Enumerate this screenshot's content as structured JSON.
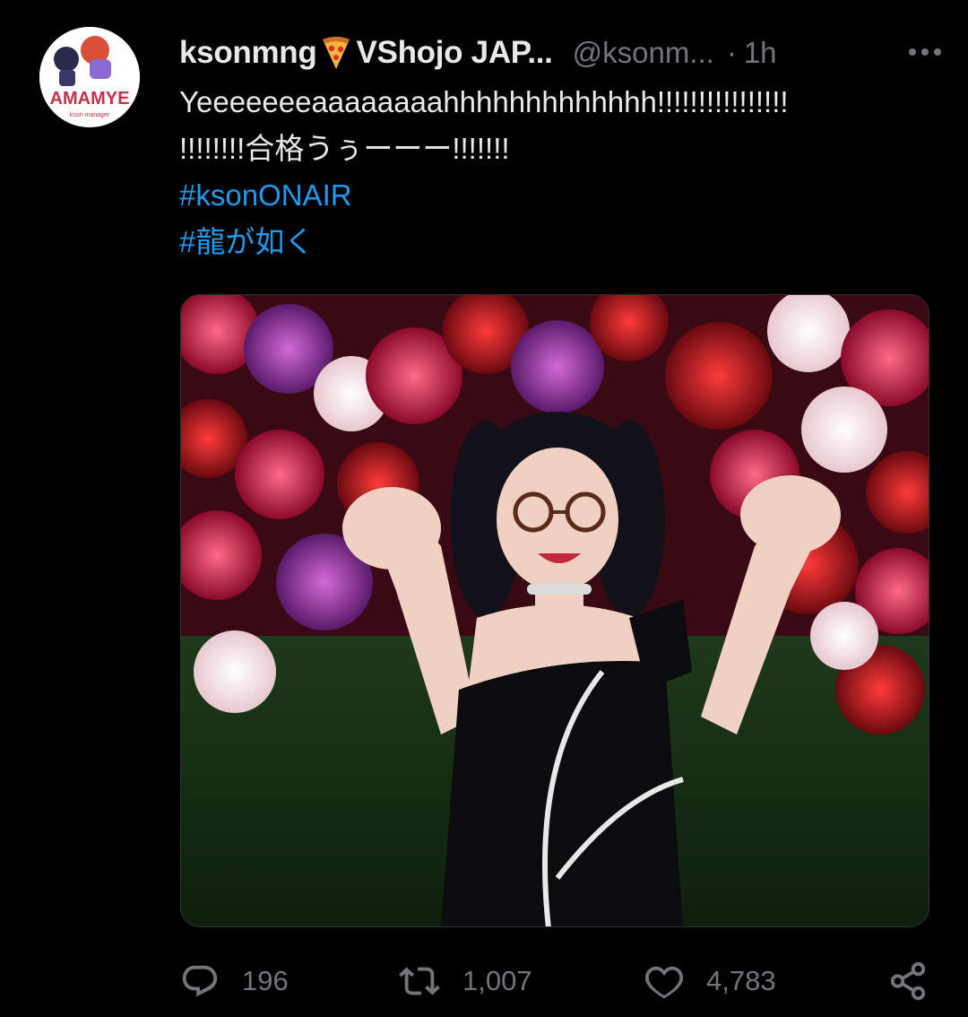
{
  "tweet": {
    "display_name": "ksonmng",
    "display_name_suffix": "VShojo JAP...",
    "handle": "@ksonm...",
    "separator": "·",
    "time": "1h",
    "text_line_1": "Yeeeeeeeaaaaaaaahhhhhhhhhhhhh!!!!!!!!!!!!!!!!",
    "text_line_2": "!!!!!!!!合格うぅーーー!!!!!!!",
    "hashtags": [
      "#ksonONAIR",
      "#龍が如く"
    ],
    "avatar_icon": "avatar-icon",
    "media_description_icon": "photo-icon"
  },
  "actions": {
    "reply_count": "196",
    "retweet_count": "1,007",
    "like_count": "4,783"
  },
  "colors": {
    "background": "#000000",
    "text": "#e7e9ea",
    "muted": "#71767b",
    "link": "#1d9bf0"
  }
}
